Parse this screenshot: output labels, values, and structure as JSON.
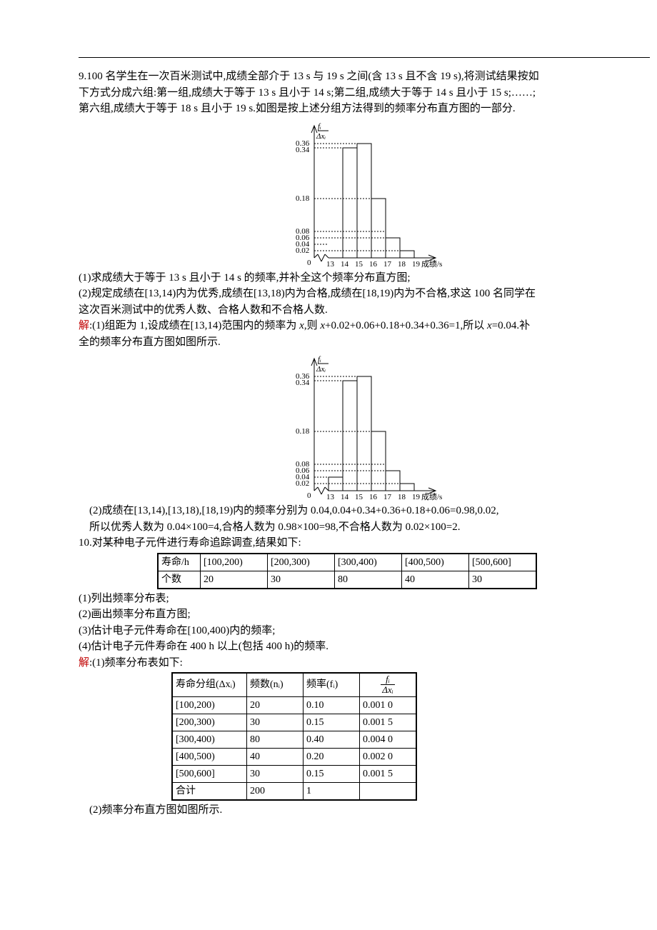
{
  "q9": {
    "intro1": "9.100 名学生在一次百米测试中,成绩全部介于 13 s 与 19 s 之间(含 13 s 且不含 19 s),将测试结果按如",
    "intro2": "下方式分成六组:第一组,成绩大于等于 13 s 且小于 14 s;第二组,成绩大于等于 14 s 且小于 15 s;……;",
    "intro3": "第六组,成绩大于等于 18 s 且小于 19 s.如图是按上述分组方法得到的频率分布直方图的一部分.",
    "p1": "(1)求成绩大于等于 13 s 且小于 14 s 的频率,并补全这个频率分布直方图;",
    "p2": "(2)规定成绩在[13,14)内为优秀,成绩在[13,18)内为合格,成绩在[18,19)内为不合格,求这 100 名同学在",
    "p2b": "这次百米测试中的优秀人数、合格人数和不合格人数.",
    "ans_label": "解",
    "ans1a": ":(1)组距为 1,设成绩在[13,14)范围内的频率为 ",
    "ans1b": ",则 ",
    "ans1c": "+0.02+0.06+0.18+0.34+0.36=1,所以 ",
    "ans1d": "=0.04.补",
    "ans1e": "全的频率分布直方图如图所示.",
    "ans2a": "(2)成绩在[13,14),[13,18),[18,19)内的频率分别为 0.04,0.04+0.34+0.36+0.18+0.06=0.98,0.02,",
    "ans2b": "所以优秀人数为 0.04×100=4,合格人数为 0.98×100=98,不合格人数为 0.02×100=2.",
    "x_var": "x"
  },
  "q10": {
    "intro": "10.对某种电子元件进行寿命追踪调查,结果如下:",
    "rowh1": "寿命/h",
    "rowh2": "个数",
    "cols": [
      "[100,200)",
      "[200,300)",
      "[300,400)",
      "[400,500)",
      "[500,600]"
    ],
    "counts": [
      "20",
      "30",
      "80",
      "40",
      "30"
    ],
    "p1": "(1)列出频率分布表;",
    "p2": "(2)画出频率分布直方图;",
    "p3": "(3)估计电子元件寿命在[100,400)内的频率;",
    "p4": "(4)估计电子元件寿命在 400 h 以上(包括 400 h)的频率.",
    "ans_label": "解",
    "ans1": ":(1)频率分布表如下:",
    "ans2": "(2)频率分布直方图如图所示.",
    "table": {
      "h1": "寿命分组(Δxᵢ)",
      "h2": "频数(nᵢ)",
      "h3": "频率(fᵢ)",
      "h4_num": "fᵢ",
      "h4_den": "Δxᵢ",
      "rows": [
        [
          "[100,200)",
          "20",
          "0.10",
          "0.001 0"
        ],
        [
          "[200,300)",
          "30",
          "0.15",
          "0.001 5"
        ],
        [
          "[300,400)",
          "80",
          "0.40",
          "0.004 0"
        ],
        [
          "[400,500)",
          "40",
          "0.20",
          "0.002 0"
        ],
        [
          "[500,600]",
          "30",
          "0.15",
          "0.001 5"
        ],
        [
          "合计",
          "200",
          "1",
          ""
        ]
      ]
    }
  },
  "histogram1": {
    "ylabel_num": "fᵢ",
    "ylabel_den": "Δxᵢ",
    "yticks": [
      "0.36",
      "0.34",
      "0.18",
      "0.08",
      "0.06",
      "0.04",
      "0.02",
      "0"
    ],
    "xticks": [
      "13",
      "14",
      "15",
      "16",
      "17",
      "18",
      "19"
    ],
    "xlabel": "成绩/s"
  },
  "histogram2": {
    "yticks": [
      "0.36",
      "0.34",
      "0.18",
      "0.08",
      "0.06",
      "0.04",
      "0.02",
      "0"
    ],
    "xticks": [
      "13",
      "14",
      "15",
      "16",
      "17",
      "18",
      "19"
    ],
    "xlabel": "成绩/s"
  },
  "chart_data": [
    {
      "type": "bar",
      "title": "频率分布直方图（部分）",
      "categories": [
        "[13,14)",
        "[14,15)",
        "[15,16)",
        "[16,17)",
        "[17,18)",
        "[18,19)"
      ],
      "values": [
        null,
        0.34,
        0.36,
        0.18,
        0.06,
        0.02
      ],
      "xlabel": "成绩/s",
      "ylabel": "fᵢ/Δxᵢ",
      "ylim": [
        0,
        0.4
      ]
    },
    {
      "type": "bar",
      "title": "补全的频率分布直方图",
      "categories": [
        "[13,14)",
        "[14,15)",
        "[15,16)",
        "[16,17)",
        "[17,18)",
        "[18,19)"
      ],
      "values": [
        0.04,
        0.34,
        0.36,
        0.18,
        0.06,
        0.02
      ],
      "xlabel": "成绩/s",
      "ylabel": "fᵢ/Δxᵢ",
      "ylim": [
        0,
        0.4
      ]
    }
  ]
}
